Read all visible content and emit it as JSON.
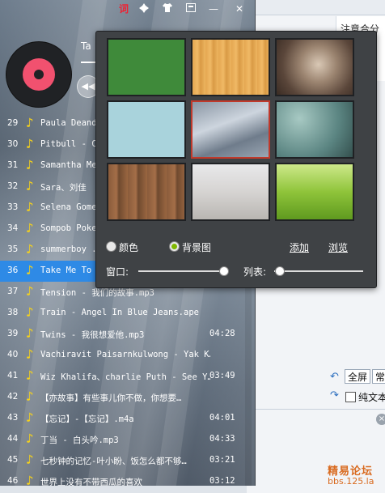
{
  "background_app": {
    "note": "注意合分",
    "fullscreen_label": "全屏",
    "normal_label": "常",
    "plain_text_label": "纯文本",
    "close_icon": "×"
  },
  "watermark": {
    "line1": "精易论坛",
    "line2": "bbs.125.la"
  },
  "player": {
    "titlebar": {
      "lyrics_label": "词",
      "icons": [
        "puzzle-icon",
        "shirt-icon",
        "minimize-icon",
        "mini-mode-icon",
        "close-icon"
      ],
      "minimize_glyph": "—",
      "close_glyph": "✕"
    },
    "now_playing_title": "Ta",
    "prev_glyph": "◀◀",
    "playlist": [
      {
        "num": "29",
        "name": "Paula Deand",
        "duration": ""
      },
      {
        "num": "30",
        "name": "Pitbull - C",
        "duration": ""
      },
      {
        "num": "31",
        "name": "Samantha Me",
        "duration": ""
      },
      {
        "num": "32",
        "name": "Sara、刘佳",
        "duration": ""
      },
      {
        "num": "33",
        "name": "Selena Gome",
        "duration": ""
      },
      {
        "num": "34",
        "name": "Sompob Poke",
        "duration": ""
      },
      {
        "num": "35",
        "name": "summerboy .",
        "duration": ""
      },
      {
        "num": "36",
        "name": "Take Me To",
        "duration": ""
      },
      {
        "num": "37",
        "name": "Tension - 我们的故事.mp3",
        "duration": ""
      },
      {
        "num": "38",
        "name": "Train - Angel In Blue Jeans.ape",
        "duration": ""
      },
      {
        "num": "39",
        "name": "Twins - 我很想爱他.mp3",
        "duration": "04:28"
      },
      {
        "num": "40",
        "name": "Vachiravit Paisarnkulwong - Yak K…",
        "duration": ""
      },
      {
        "num": "41",
        "name": "Wiz Khalifa、charlie Puth - See Y…",
        "duration": "03:49"
      },
      {
        "num": "42",
        "name": "【亦故事】有些事儿你不做，你想要…",
        "duration": ""
      },
      {
        "num": "43",
        "name": "【忘记】-【忘记】.m4a",
        "duration": "04:01"
      },
      {
        "num": "44",
        "name": "丁当 - 白头吟.mp3",
        "duration": "04:33"
      },
      {
        "num": "45",
        "name": "七秒钟的记忆-叶小盼、饭怎么都不够…",
        "duration": "03:21"
      },
      {
        "num": "46",
        "name": "世界上没有不带西瓜的喜欢",
        "duration": "03:12"
      }
    ]
  },
  "skin_panel": {
    "thumbnails": [
      {
        "name": "chalkboard",
        "selected": false
      },
      {
        "name": "wood-grain",
        "selected": false
      },
      {
        "name": "portrait",
        "selected": false
      },
      {
        "name": "whale",
        "selected": false
      },
      {
        "name": "waterfall",
        "selected": true
      },
      {
        "name": "water-drops",
        "selected": false
      },
      {
        "name": "wood-planks",
        "selected": false
      },
      {
        "name": "girl-white-dress",
        "selected": false
      },
      {
        "name": "bamboo",
        "selected": false
      }
    ],
    "color_label": "颜色",
    "background_image_label": "背景图",
    "add_label": "添加",
    "browse_label": "浏览",
    "window_label": "窗口:",
    "list_label": "列表:",
    "window_opacity": 0.95,
    "list_opacity": 0.05,
    "mode": "background_image"
  }
}
